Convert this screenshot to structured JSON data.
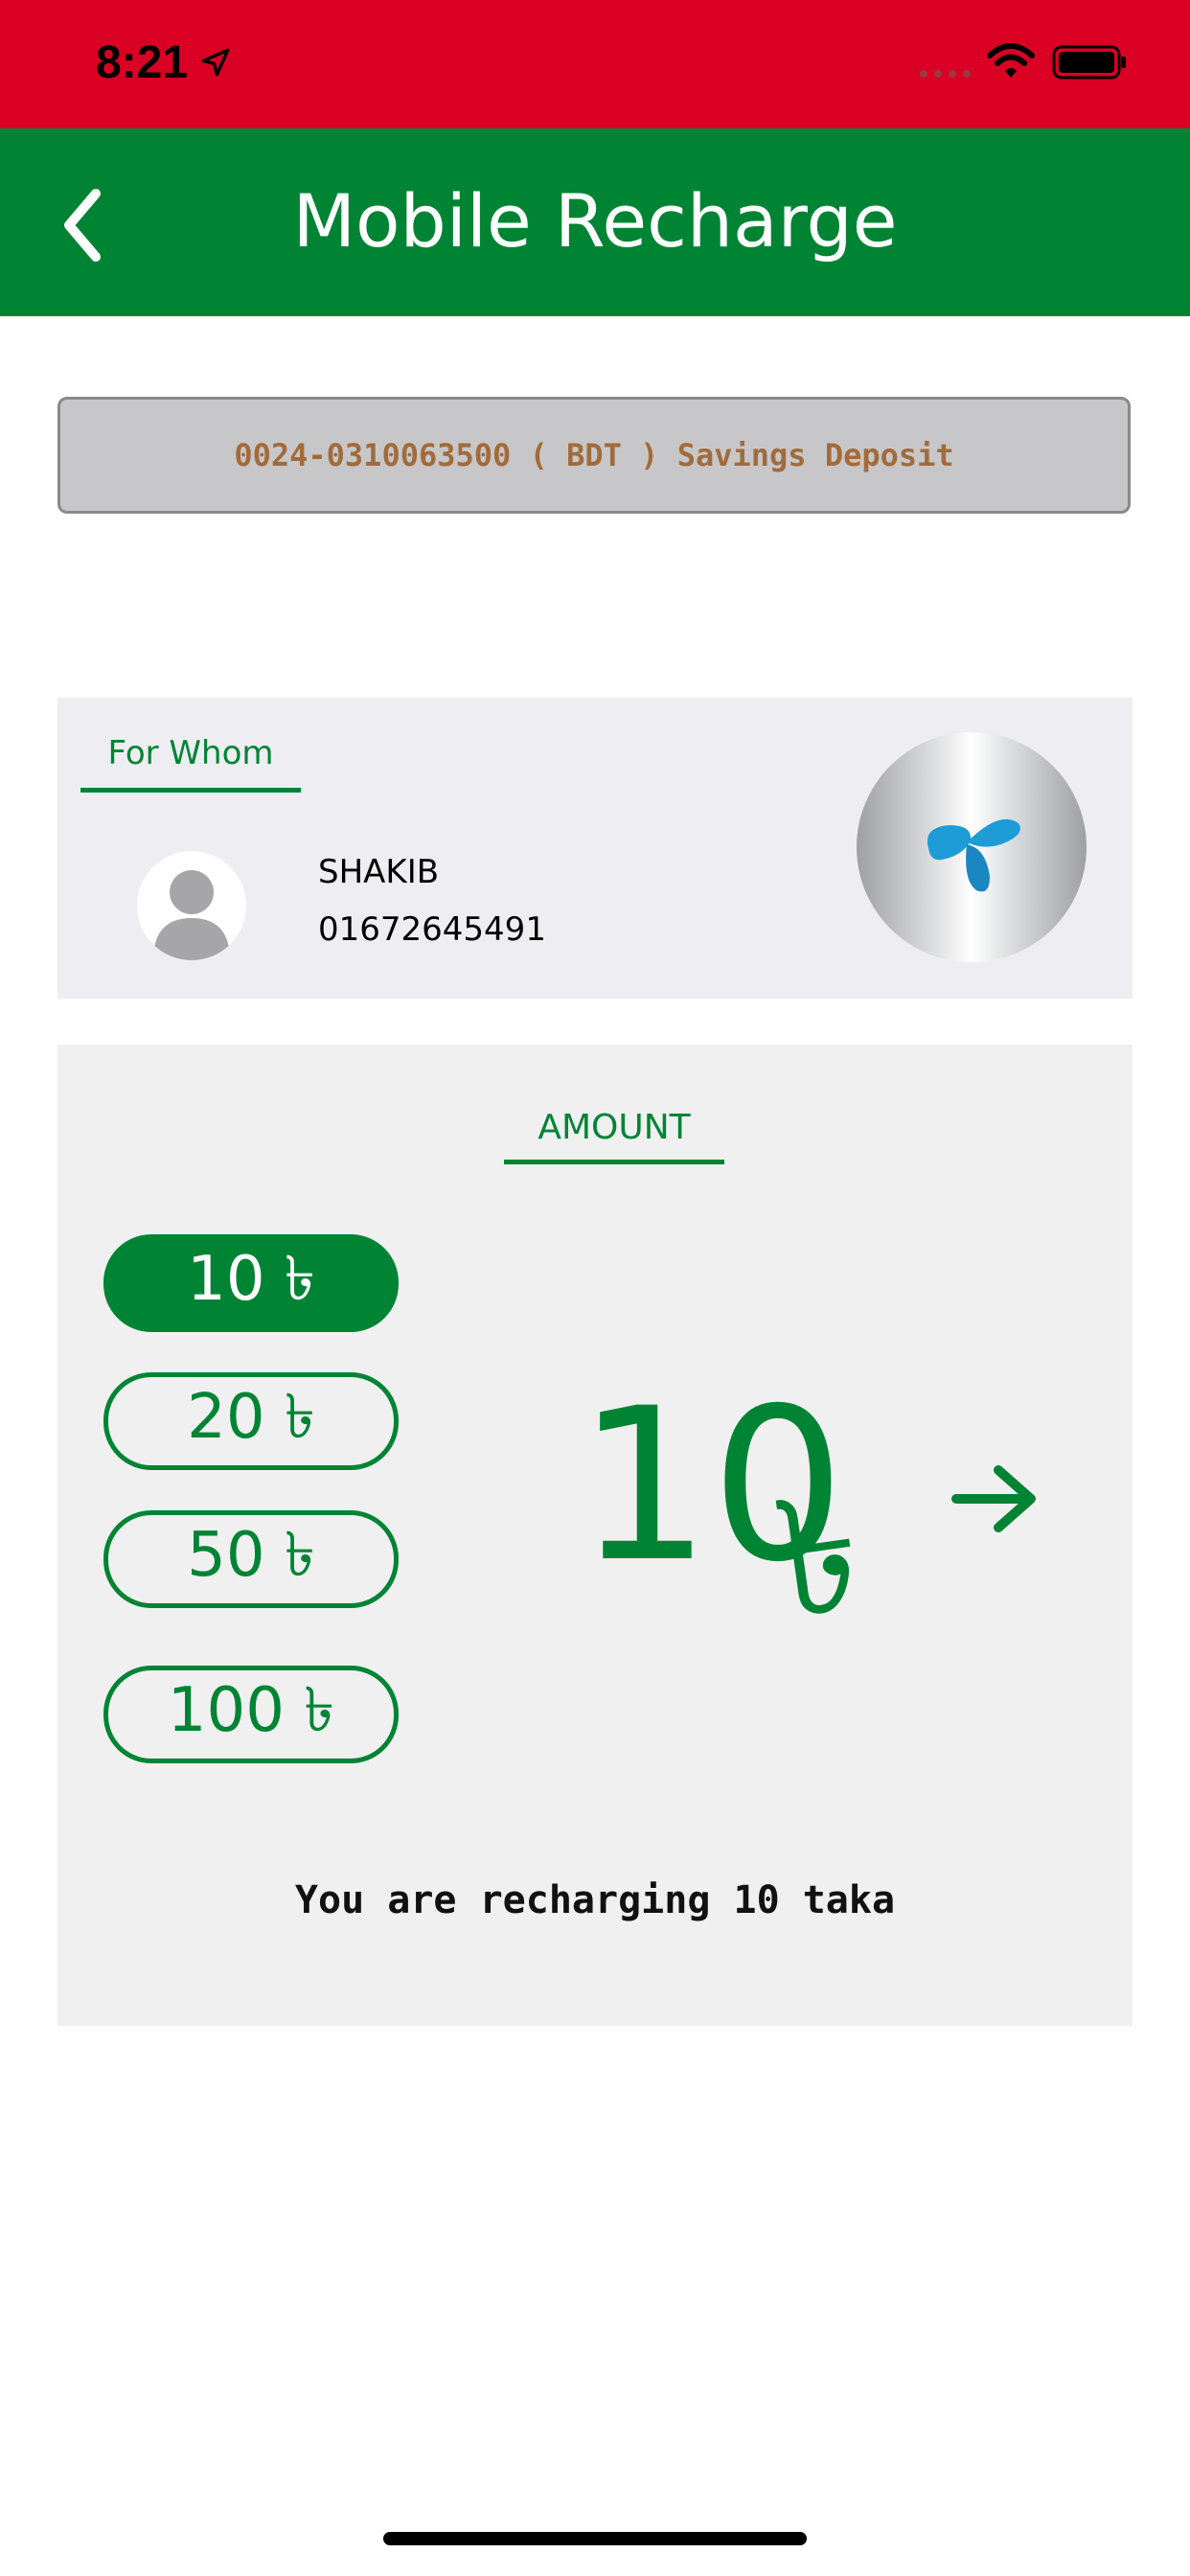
{
  "status_bar": {
    "time": "8:21",
    "background": "#d90024",
    "icons": [
      "location-arrow-icon",
      "cellular-signal-icon",
      "wifi-icon",
      "battery-icon"
    ]
  },
  "nav": {
    "title": "Mobile Recharge",
    "back_icon": "chevron-left-icon",
    "background": "#008434"
  },
  "account": {
    "label": "0024-0310063500 ( BDT )  Savings Deposit"
  },
  "for_whom": {
    "title": "For Whom",
    "contact_name": "SHAKIB",
    "contact_number": "01672645491",
    "avatar_icon": "person-icon",
    "operator_icon": "operator-logo-icon"
  },
  "amount": {
    "title": "AMOUNT",
    "options": [
      {
        "label": "10 ৳",
        "selected": true
      },
      {
        "label": "20 ৳",
        "selected": false
      },
      {
        "label": "50 ৳",
        "selected": false
      },
      {
        "label": "100 ৳",
        "selected": false
      }
    ],
    "selected_value": "10",
    "currency_symbol": "৳",
    "next_icon": "arrow-right-icon",
    "summary": "You are recharging 10 taka"
  },
  "colors": {
    "primary_green": "#008434",
    "status_red": "#d90024",
    "account_text": "#a26b3b"
  }
}
